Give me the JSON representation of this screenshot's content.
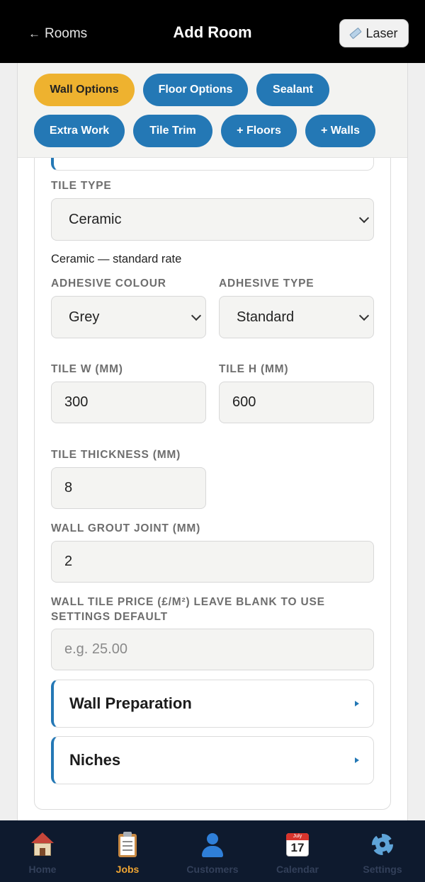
{
  "header": {
    "back_label": "Rooms",
    "title": "Add Room",
    "laser_label": "Laser"
  },
  "chips": [
    {
      "label": "Wall Options",
      "active": true
    },
    {
      "label": "Floor Options",
      "active": false
    },
    {
      "label": "Sealant",
      "active": false
    },
    {
      "label": "Extra Work",
      "active": false
    },
    {
      "label": "Tile Trim",
      "active": false
    },
    {
      "label": "+ Floors",
      "active": false
    },
    {
      "label": "+ Walls",
      "active": false
    }
  ],
  "form": {
    "tile_type": {
      "label": "TILE TYPE",
      "value": "Ceramic",
      "note": "Ceramic — standard rate"
    },
    "adhesive_colour": {
      "label": "ADHESIVE COLOUR",
      "value": "Grey"
    },
    "adhesive_type": {
      "label": "ADHESIVE TYPE",
      "value": "Standard"
    },
    "tile_w": {
      "label": "TILE W (MM)",
      "value": "300"
    },
    "tile_h": {
      "label": "TILE H (MM)",
      "value": "600"
    },
    "tile_thickness": {
      "label": "TILE THICKNESS (MM)",
      "value": "8"
    },
    "wall_grout_joint": {
      "label": "WALL GROUT JOINT (MM)",
      "value": "2"
    },
    "wall_tile_price": {
      "label_line1": "WALL TILE PRICE (£/M²) LEAVE BLANK TO USE",
      "label_line2": "SETTINGS DEFAULT",
      "placeholder": "e.g. 25.00",
      "value": ""
    }
  },
  "sections": [
    {
      "title": "Wall Preparation"
    },
    {
      "title": "Niches"
    }
  ],
  "tabbar": [
    {
      "label": "Home",
      "icon": "house-icon",
      "active": false
    },
    {
      "label": "Jobs",
      "icon": "clipboard-icon",
      "active": true
    },
    {
      "label": "Customers",
      "icon": "user-icon",
      "active": false
    },
    {
      "label": "Calendar",
      "icon": "calendar-icon",
      "active": false,
      "icon_month": "July",
      "icon_day": "17"
    },
    {
      "label": "Settings",
      "icon": "gear-icon",
      "active": false
    }
  ],
  "colors": {
    "accent_blue": "#2478b5",
    "active_chip": "#eeb22f",
    "tab_active": "#f0a532",
    "header_bg": "#000000",
    "tabbar_bg": "#0e1a2e"
  }
}
